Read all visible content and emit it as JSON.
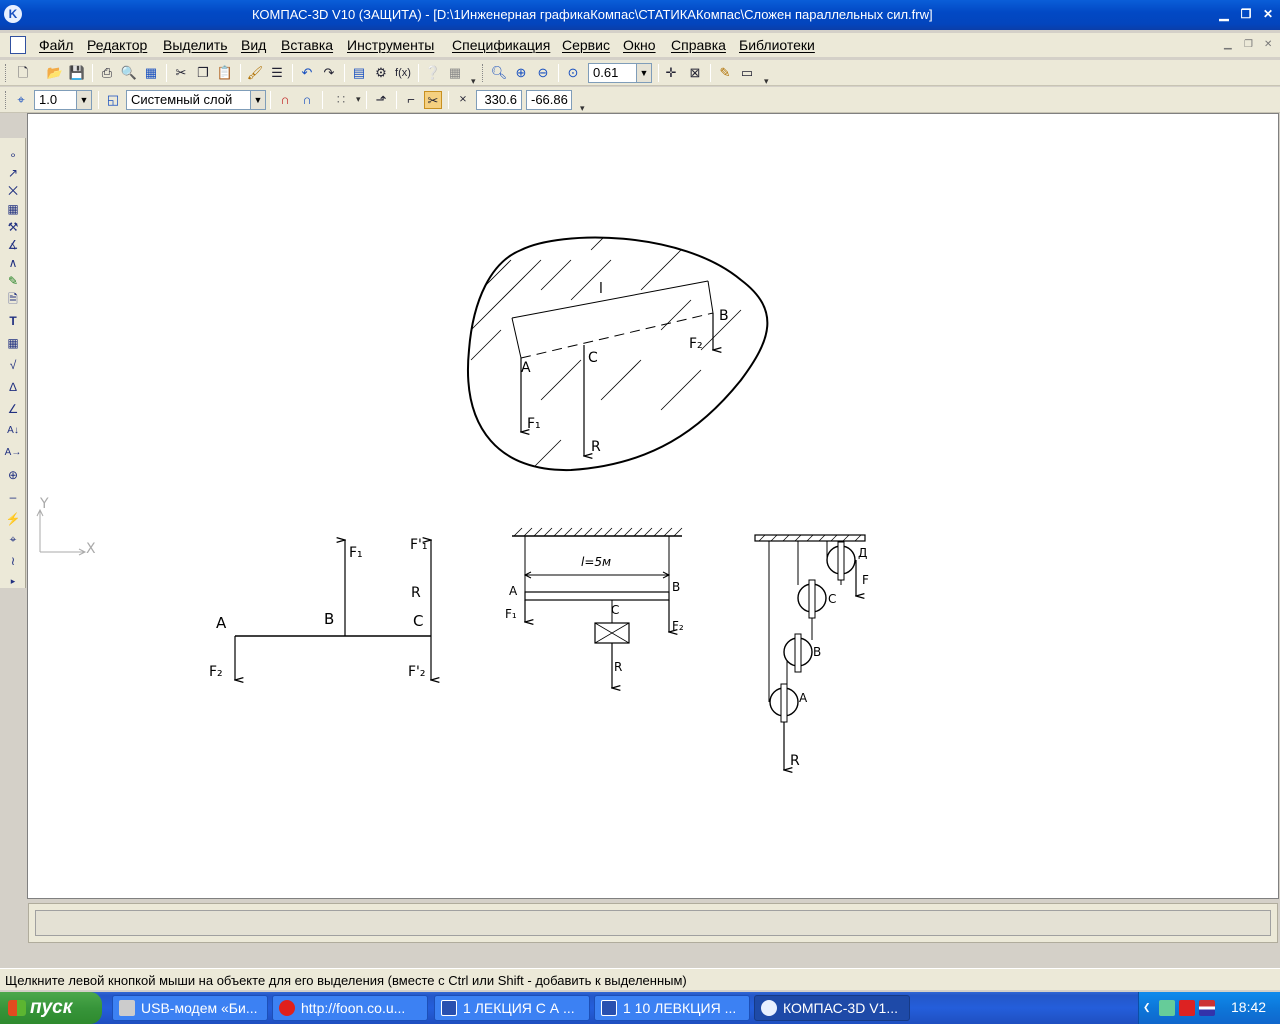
{
  "window": {
    "title": "КОМПАС-3D V10 (ЗАЩИТА) - [D:\\1Инженерная графикаКомпас\\СТАТИКАКомпас\\Сложен параллельных сил.frw]",
    "app_icon_letter": "K"
  },
  "menu": {
    "items": [
      "Файл",
      "Редактор",
      "Выделить",
      "Вид",
      "Вставка",
      "Инструменты",
      "Спецификация",
      "Сервис",
      "Окно",
      "Справка",
      "Библиотеки"
    ]
  },
  "toolbar1": {
    "zoom_value": "0.61"
  },
  "toolbar2": {
    "step_value": "1.0",
    "layer_value": "Системный слой",
    "coord_x": "330.6",
    "coord_y": "-66.86"
  },
  "drawing": {
    "fig1": {
      "label_l": "l",
      "label_A": "A",
      "label_B": "B",
      "label_C": "C",
      "label_F1": "F₁",
      "label_F2": "F₂",
      "label_R": "R"
    },
    "fig2": {
      "label_A": "A",
      "label_B": "B",
      "label_C": "C",
      "label_F1": "F₁",
      "label_F2": "F₂",
      "label_F1p": "F'₁",
      "label_F2p": "F'₂",
      "label_R": "R"
    },
    "fig3": {
      "label_l": "l=5м",
      "label_A": "A",
      "label_B": "B",
      "label_C": "C",
      "label_F1": "F₁",
      "label_F2": "F₂",
      "label_R": "R"
    },
    "fig4": {
      "label_D": "Д",
      "label_F": "F",
      "label_C": "C",
      "label_B": "B",
      "label_A": "A",
      "label_R": "R"
    },
    "axes": {
      "x": "X",
      "y": "Y"
    }
  },
  "status": {
    "hint": "Щелкните левой кнопкой мыши на объекте для его выделения (вместе с Ctrl или Shift - добавить к выделенным)"
  },
  "taskbar": {
    "start_label": "пуск",
    "tasks": [
      "USB-модем «Би...",
      "http://foon.co.u...",
      "1  ЛЕКЦИЯ С А ...",
      "1 10 ЛЕВКЦИЯ ...",
      "КОМПАС-3D V1..."
    ],
    "clock": "18:42"
  }
}
